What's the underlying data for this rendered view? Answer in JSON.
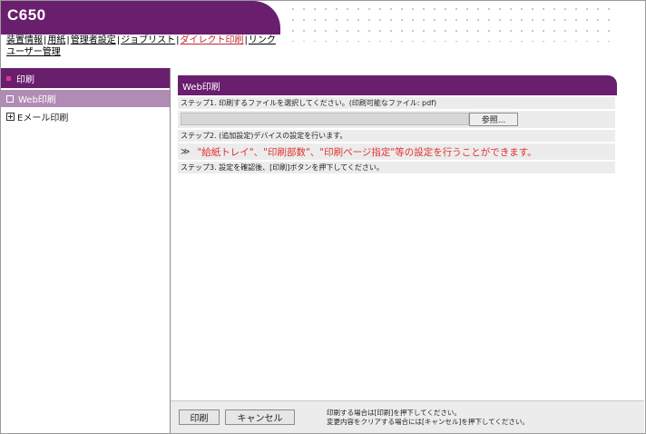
{
  "header": {
    "title": "C650",
    "nav": [
      {
        "label": "装置情報",
        "active": false
      },
      {
        "label": "用紙",
        "active": false
      },
      {
        "label": "管理者設定",
        "active": false
      },
      {
        "label": "ジョブリスト",
        "active": false
      },
      {
        "label": "ダイレクト印刷",
        "active": true
      },
      {
        "label": "リンク",
        "active": false
      }
    ],
    "nav_row2": "ユーザー管理"
  },
  "sidebar": {
    "heading": "印刷",
    "items": [
      {
        "label": "Web印刷",
        "active": true
      },
      {
        "label": "Eメール印刷",
        "active": false
      }
    ]
  },
  "main": {
    "panel_title": "Web印刷",
    "step1": "ステップ1. 印刷するファイルを選択してください。(印刷可能なファイル: pdf)",
    "file_input_value": "",
    "browse_label": "参照...",
    "step2": "ステップ2. (追加設定)デバイスの設定を行います。",
    "step2_arrow": "≫",
    "step2_note": "\"給紙トレイ\"、\"印刷部数\"、\"印刷ページ指定\"等の設定を行うことができます。",
    "step3": "ステップ3. 設定を確認後、[印刷]ボタンを押下してください。"
  },
  "footer": {
    "print_label": "印刷",
    "cancel_label": "キャンセル",
    "note_line1": "印刷する場合は[印刷]を押下してください。",
    "note_line2": "変更内容をクリアする場合には[キャンセル]を押下してください。"
  },
  "colors": {
    "brand": "#6a1e6e",
    "active_item": "#b08cb5",
    "nav_active": "#c0282e",
    "note_red": "#e03030"
  }
}
